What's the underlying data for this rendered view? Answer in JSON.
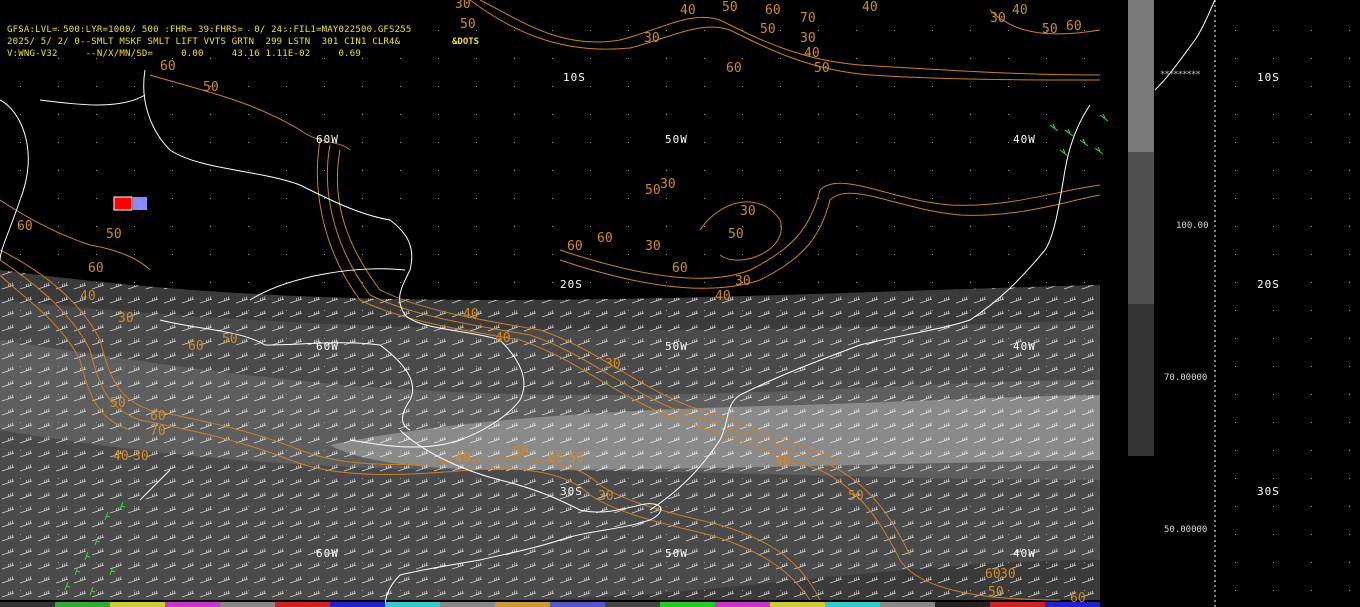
{
  "header": {
    "line1": "GFSA:LVL= 500:LYR=1000/ 500 :FHR= 39:FHRS=  0/ 24::FIL1=MAY022500.GFS255",
    "line2": "2025/ 5/ 2/ 0--SMLT MSKF SMLT LIFT VVTS GRTN  299 LSTN  301 CIN1 CLR4&",
    "line3": "V:WNG-V32     --N/X/MN/SD=     0.00     43.16 1.11E-02     0.69",
    "dots_label": "&DOTS"
  },
  "grid_labels": {
    "lat": [
      "10S",
      "20S",
      "30S"
    ],
    "lon": [
      "60W",
      "50W",
      "40W"
    ]
  },
  "contour_labels": [
    "30",
    "40",
    "50",
    "60",
    "70",
    "40",
    "30",
    "40",
    "50",
    "60",
    "50",
    "30",
    "40",
    "50",
    "60",
    "30",
    "50",
    "60",
    "50",
    "60",
    "50",
    "60",
    "40",
    "30",
    "60",
    "50",
    "40",
    "40",
    "30",
    "50",
    "30",
    "30",
    "50",
    "60",
    "60",
    "30",
    "60"
  ],
  "side_panel": {
    "lat_labels": [
      "10S",
      "20S",
      "30S"
    ],
    "scale_values": [
      "100.00",
      "70.00000",
      "50.00000"
    ],
    "stars": "*********"
  },
  "colors": {
    "background": "#000000",
    "coastline": "#ffffff",
    "contour": "#c97f28",
    "header_text": "#f0e030",
    "wind_barbs_green": "#33dd33",
    "shade_light": "#8a8a8a",
    "shade_mid": "#5a5a5a",
    "shade_dark": "#3a3a3a"
  },
  "legend_marker": {
    "icon": "station-marker-icon"
  }
}
